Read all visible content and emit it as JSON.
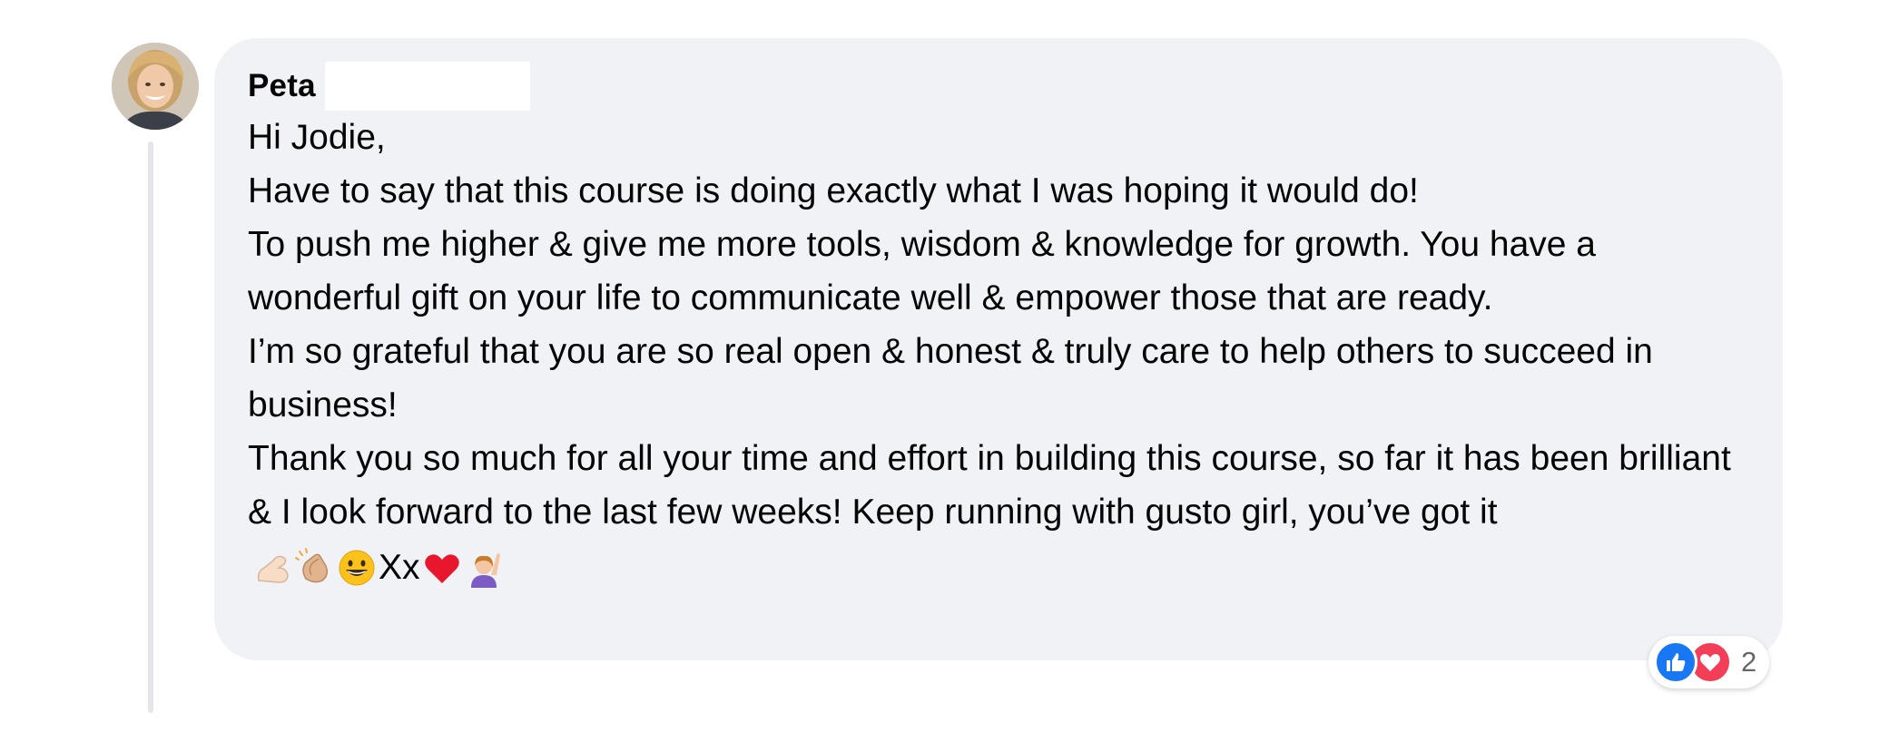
{
  "comment": {
    "author": "Peta",
    "lines": [
      "Hi Jodie,",
      "Have to say that this course is doing exactly what I was hoping it would do!",
      "To push me higher & give me more tools, wisdom & knowledge for growth. You have a wonderful gift on your life to communicate well & empower those that are ready.",
      "I’m so grateful that you are so real open & honest & truly care to help others to succeed in business!",
      "Thank you so much for all your time and effort in building this course, so far it has been brilliant & I look forward to the last few weeks! Keep running with gusto girl, you’ve got it"
    ],
    "emoji_text": "Xx",
    "emojis": [
      "flexed-biceps",
      "clapping-hands",
      "grinning-face",
      "red-heart",
      "person-raising-hand"
    ]
  },
  "reactions": {
    "icons": [
      "like-icon",
      "love-icon"
    ],
    "count": "2"
  },
  "colors": {
    "bubble_bg": "#f0f2f5",
    "text": "#050505",
    "like_blue": "#1877f2",
    "love_red": "#f33e58",
    "count_gray": "#65676b"
  }
}
